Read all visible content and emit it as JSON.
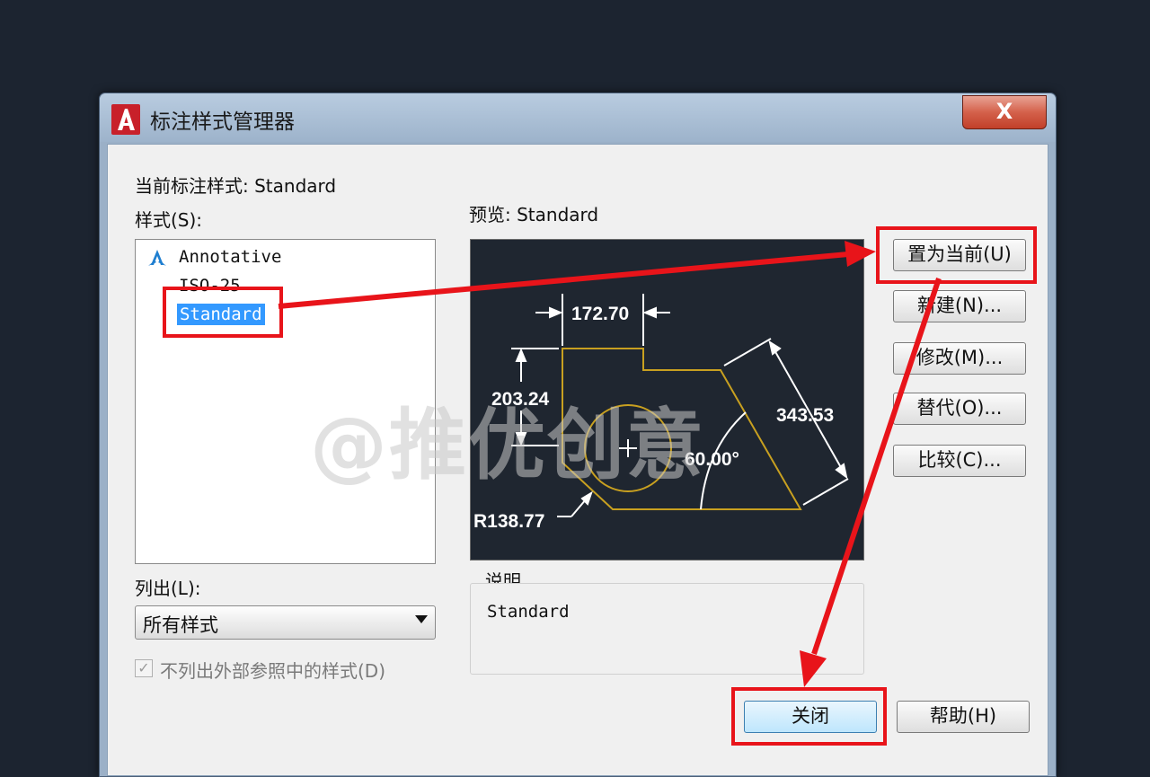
{
  "dialog": {
    "title": "标注样式管理器",
    "close_label": "X",
    "current_style_label": "当前标注样式: Standard",
    "styles_label": "样式(S):",
    "styles": [
      "Annotative",
      "ISO-25",
      "Standard"
    ],
    "selected_style": "Standard",
    "list_label": "列出(L):",
    "list_value": "所有样式",
    "exclude_xref_label": "不列出外部参照中的样式(D)",
    "exclude_xref_checked": true,
    "preview_label": "预览: Standard",
    "description_label": "说明",
    "description_value": "Standard"
  },
  "preview": {
    "dim_top": "172.70",
    "dim_left": "203.24",
    "dim_right": "343.53",
    "dim_angle": "60.00°",
    "dim_radius": "R138.77"
  },
  "buttons": {
    "set_current": "置为当前(U)",
    "new": "新建(N)...",
    "modify": "修改(M)...",
    "override": "替代(O)...",
    "compare": "比较(C)...",
    "close": "关闭",
    "help": "帮助(H)"
  },
  "watermark": "@推优创意",
  "colors": {
    "annotation_red": "#e8141a",
    "selection_blue": "#3399ff",
    "preview_bg": "#1f2630",
    "geometry_gold": "#c8a020"
  }
}
